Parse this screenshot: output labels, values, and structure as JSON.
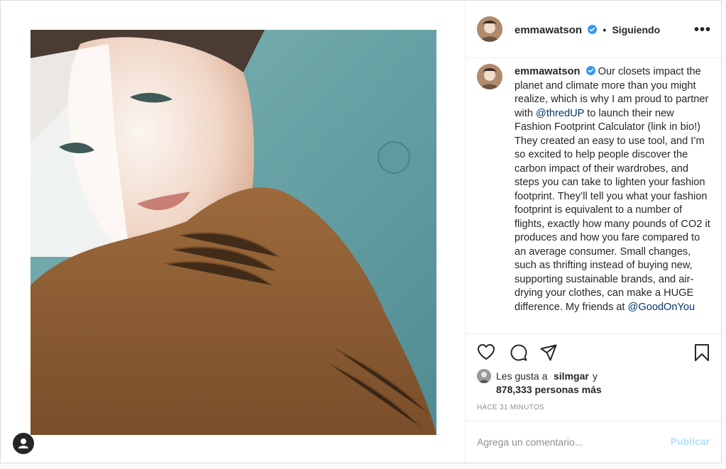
{
  "post": {
    "username": "emmawatson",
    "separator": "•",
    "follow_status": "Siguiendo",
    "more_icon_glyph": "•••",
    "caption": {
      "username": "emmawatson",
      "part1": "Our closets impact the planet and climate more than you might realize, which is why I am proud to partner with",
      "mention1": "@thredUP",
      "part2": "to launch their new Fashion Footprint Calculator (link in bio!) They created an easy to use tool, and I’m so excited to help people discover the carbon impact of their wardrobes, and steps you can take to lighten your fashion footprint. They’ll tell you what your fashion footprint is equivalent to a number of flights, exactly how many pounds of CO2 it produces and how you fare compared to an average consumer. Small changes, such as thrifting instead of buying new, supporting sustainable brands, and air-drying your clothes, can make a HUGE difference. My friends at",
      "mention2": "@GoodOnYou"
    },
    "likes": {
      "prefix": "Les gusta a",
      "user": "silmgar",
      "suffix": "y",
      "count_text": "878,333 personas más"
    },
    "timestamp": "HACE 31 MINUTOS",
    "comment": {
      "placeholder": "Agrega un comentario...",
      "post_label": "Publicar"
    }
  },
  "icons": {
    "verified": "verified-badge-icon",
    "like": "heart-icon",
    "comment": "comment-bubble-icon",
    "share": "paper-plane-icon",
    "save": "bookmark-icon",
    "more": "more-options-icon",
    "profile": "user-icon"
  },
  "colors": {
    "verified": "#3897f0",
    "mention": "#00376b",
    "post_button_disabled": "#b2dffc",
    "border": "#dbdbdb"
  }
}
